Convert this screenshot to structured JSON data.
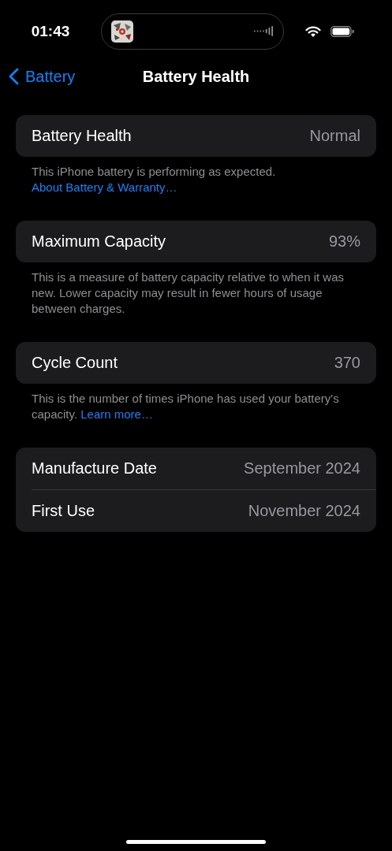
{
  "status_bar": {
    "time": "01:43"
  },
  "nav": {
    "back": "Battery",
    "title": "Battery Health"
  },
  "sections": [
    {
      "rows": [
        {
          "label": "Battery Health",
          "value": "Normal"
        }
      ],
      "footer": {
        "text": "This iPhone battery is performing as expected. ",
        "link": "About Battery & Warranty…"
      }
    },
    {
      "rows": [
        {
          "label": "Maximum Capacity",
          "value": "93%"
        }
      ],
      "footer": {
        "text": "This is a measure of battery capacity relative to when it was new. Lower capacity may result in fewer hours of usage between charges."
      }
    },
    {
      "rows": [
        {
          "label": "Cycle Count",
          "value": "370"
        }
      ],
      "footer": {
        "text": "This is the number of times iPhone has used your battery's capacity. ",
        "link": "Learn more…"
      }
    },
    {
      "rows": [
        {
          "label": "Manufacture Date",
          "value": "September 2024"
        },
        {
          "label": "First Use",
          "value": "November 2024"
        }
      ]
    }
  ]
}
